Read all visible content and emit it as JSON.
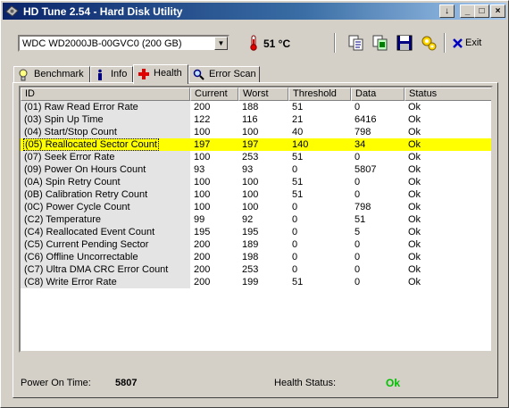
{
  "window": {
    "title": "HD Tune 2.54 - Hard Disk Utility"
  },
  "titlebar_buttons": {
    "help": "↓",
    "minimize": "_",
    "maximize": "□",
    "close": "×"
  },
  "toolbar": {
    "drive": "WDC WD2000JB-00GVC0 (200 GB)",
    "temperature": "51 °C",
    "exit_label": "Exit",
    "icons": [
      "copy-text-icon",
      "copy-screenshot-icon",
      "save-icon",
      "options-icon",
      "exit-icon"
    ]
  },
  "tabs": [
    {
      "label": "Benchmark",
      "icon": "bulb-icon",
      "active": false
    },
    {
      "label": "Info",
      "icon": "info-icon",
      "active": false
    },
    {
      "label": "Health",
      "icon": "health-cross-icon",
      "active": true
    },
    {
      "label": "Error Scan",
      "icon": "magnifier-icon",
      "active": false
    }
  ],
  "table": {
    "columns": [
      "ID",
      "Current",
      "Worst",
      "Threshold",
      "Data",
      "Status"
    ],
    "rows": [
      [
        "(01) Raw Read Error Rate",
        "200",
        "188",
        "51",
        "0",
        "Ok"
      ],
      [
        "(03) Spin Up Time",
        "122",
        "116",
        "21",
        "6416",
        "Ok"
      ],
      [
        "(04) Start/Stop Count",
        "100",
        "100",
        "40",
        "798",
        "Ok"
      ],
      [
        "(05) Reallocated Sector Count",
        "197",
        "197",
        "140",
        "34",
        "Ok"
      ],
      [
        "(07) Seek Error Rate",
        "100",
        "253",
        "51",
        "0",
        "Ok"
      ],
      [
        "(09) Power On Hours Count",
        "93",
        "93",
        "0",
        "5807",
        "Ok"
      ],
      [
        "(0A) Spin Retry Count",
        "100",
        "100",
        "51",
        "0",
        "Ok"
      ],
      [
        "(0B) Calibration Retry Count",
        "100",
        "100",
        "51",
        "0",
        "Ok"
      ],
      [
        "(0C) Power Cycle Count",
        "100",
        "100",
        "0",
        "798",
        "Ok"
      ],
      [
        "(C2) Temperature",
        "99",
        "92",
        "0",
        "51",
        "Ok"
      ],
      [
        "(C4) Reallocated Event Count",
        "195",
        "195",
        "0",
        "5",
        "Ok"
      ],
      [
        "(C5) Current Pending Sector",
        "200",
        "189",
        "0",
        "0",
        "Ok"
      ],
      [
        "(C6) Offline Uncorrectable",
        "200",
        "198",
        "0",
        "0",
        "Ok"
      ],
      [
        "(C7) Ultra DMA CRC Error Count",
        "200",
        "253",
        "0",
        "0",
        "Ok"
      ],
      [
        "(C8) Write Error Rate",
        "200",
        "199",
        "51",
        "0",
        "Ok"
      ]
    ],
    "highlighted_row": 3
  },
  "footer": {
    "power_on_label": "Power On Time:",
    "power_on_value": "5807",
    "health_label": "Health Status:",
    "health_value": "Ok"
  },
  "colors": {
    "highlight": "#ffff00",
    "status_ok": "#00c000",
    "title_start": "#0a246a",
    "title_end": "#a6caf0"
  }
}
